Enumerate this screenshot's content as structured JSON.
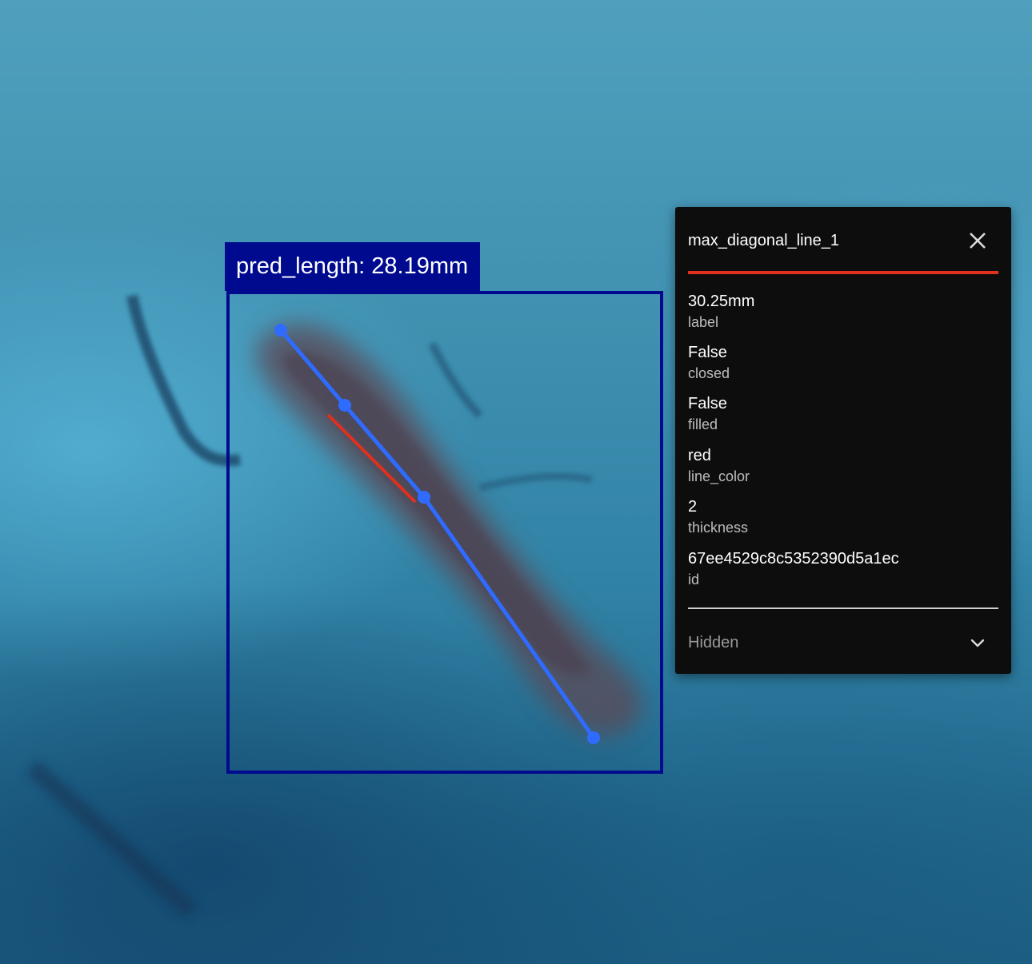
{
  "detection": {
    "label": "pred_length: 28.19mm",
    "box_color": "#000a8f"
  },
  "overlay": {
    "polyline_color": "#2f6bff",
    "red_line_color": "#e0301e"
  },
  "panel": {
    "title": "max_diagonal_line_1",
    "close_icon": "close-icon",
    "accent_color": "#e0301e",
    "properties": [
      {
        "value": "30.25mm",
        "key": "label"
      },
      {
        "value": "False",
        "key": "closed"
      },
      {
        "value": "False",
        "key": "filled"
      },
      {
        "value": "red",
        "key": "line_color"
      },
      {
        "value": "2",
        "key": "thickness"
      },
      {
        "value": "67ee4529c8c5352390d5a1ec",
        "key": "id"
      }
    ],
    "hidden_section": {
      "label": "Hidden",
      "icon": "chevron-down-icon"
    }
  }
}
